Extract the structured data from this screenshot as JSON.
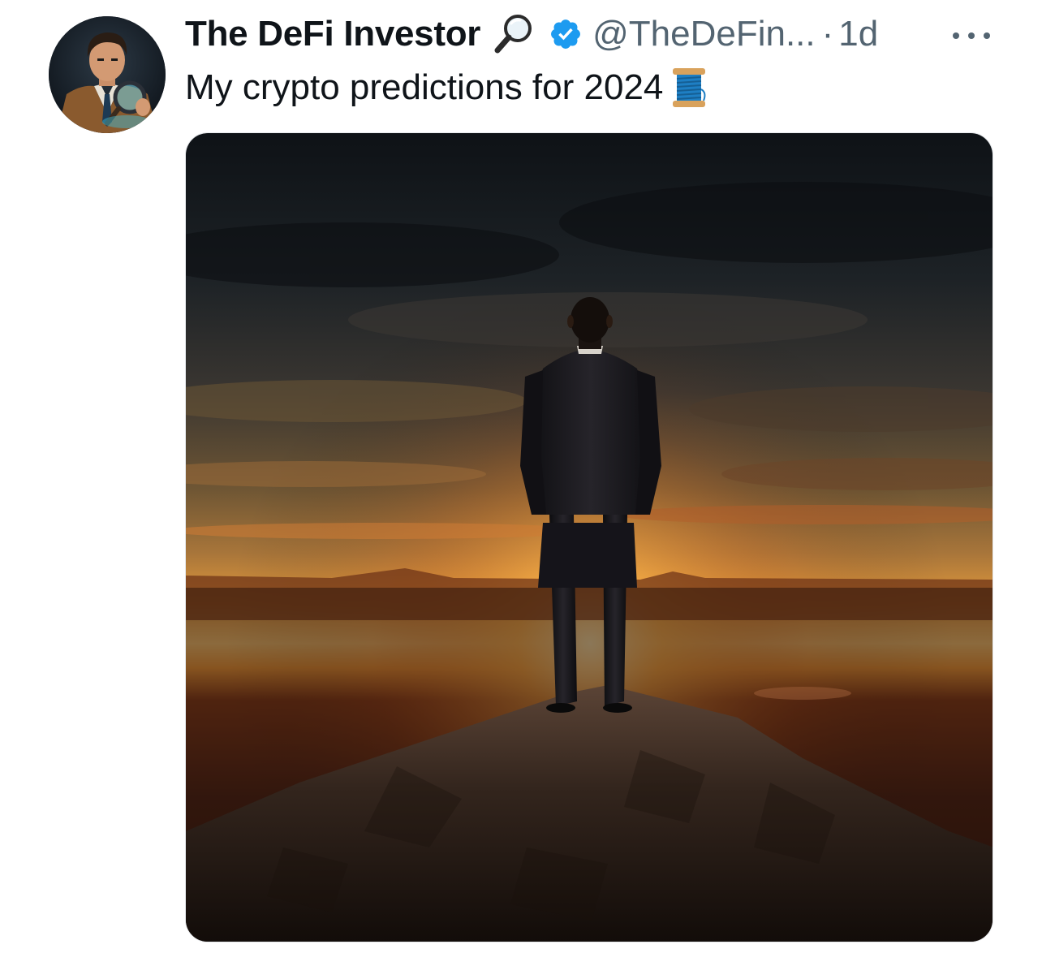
{
  "tweet": {
    "author": {
      "display_name": "The DeFi Investor",
      "name_emoji": "magnifying-glass-emoji",
      "verified": true,
      "verified_color": "#1d9bf0",
      "handle": "@TheDeFin...",
      "separator": "·",
      "timestamp": "1d",
      "avatar": "avatar-detective-illustration"
    },
    "text": "My crypto predictions for 2024",
    "text_emoji": "spool-of-thread-emoji",
    "media": {
      "type": "image",
      "subject": "man-in-suit-on-mountain-at-sunset"
    },
    "more_icon": "more-horizontal-icon"
  },
  "colors": {
    "primary_text": "#0f1419",
    "secondary_text": "#536471",
    "accent": "#1d9bf0"
  }
}
